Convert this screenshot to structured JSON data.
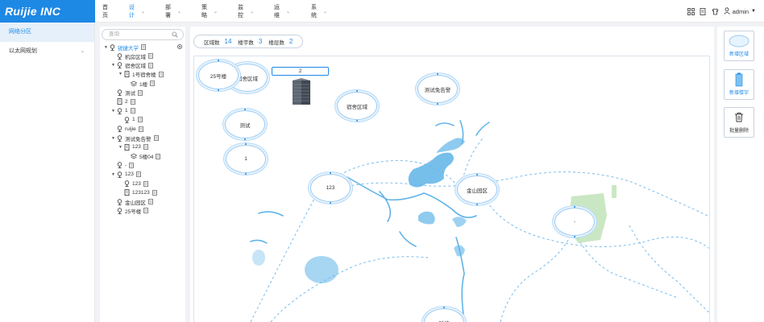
{
  "brand": {
    "logo_text": "Ruijie INC"
  },
  "nav": {
    "items": [
      {
        "label": "首页",
        "has_chevron": false,
        "active": false
      },
      {
        "label": "设计",
        "has_chevron": true,
        "active": true
      },
      {
        "label": "部署",
        "has_chevron": true,
        "active": false
      },
      {
        "label": "策略",
        "has_chevron": true,
        "active": false
      },
      {
        "label": "监控",
        "has_chevron": true,
        "active": false
      },
      {
        "label": "运维",
        "has_chevron": true,
        "active": false
      },
      {
        "label": "系统",
        "has_chevron": true,
        "active": false
      }
    ]
  },
  "header": {
    "user": "admin"
  },
  "sidebar": {
    "items": [
      {
        "label": "网络分区",
        "active": true
      },
      {
        "label": "以太网规划",
        "active": false
      }
    ]
  },
  "tree": {
    "search_placeholder": "查询",
    "nodes": [
      {
        "label": "锐捷大学",
        "depth": 0,
        "caret": "down",
        "icon": "pin",
        "selected": true
      },
      {
        "label": "机房区域",
        "depth": 1,
        "caret": "",
        "icon": "pin"
      },
      {
        "label": "宿舍区域",
        "depth": 1,
        "caret": "down",
        "icon": "pin"
      },
      {
        "label": "1号宿舍楼",
        "depth": 2,
        "caret": "down",
        "icon": "building"
      },
      {
        "label": "1楼",
        "depth": 3,
        "caret": "",
        "icon": "layers"
      },
      {
        "label": "测试",
        "depth": 1,
        "caret": "",
        "icon": "pin"
      },
      {
        "label": "2",
        "depth": 1,
        "caret": "",
        "icon": "building"
      },
      {
        "label": "1",
        "depth": 1,
        "caret": "down",
        "icon": "pin"
      },
      {
        "label": "1",
        "depth": 2,
        "caret": "",
        "icon": "pin"
      },
      {
        "label": "ruijie",
        "depth": 1,
        "caret": "",
        "icon": "pin"
      },
      {
        "label": "测试免告警",
        "depth": 1,
        "caret": "down",
        "icon": "pin"
      },
      {
        "label": "123",
        "depth": 2,
        "caret": "down",
        "icon": "building"
      },
      {
        "label": "5楼04",
        "depth": 3,
        "caret": "",
        "icon": "layers"
      },
      {
        "label": "-",
        "depth": 1,
        "caret": "",
        "icon": "pin"
      },
      {
        "label": "123",
        "depth": 1,
        "caret": "down",
        "icon": "pin"
      },
      {
        "label": "123",
        "depth": 2,
        "caret": "",
        "icon": "pin"
      },
      {
        "label": "123123",
        "depth": 2,
        "caret": "",
        "icon": "building"
      },
      {
        "label": "金山园区",
        "depth": 1,
        "caret": "",
        "icon": "pin"
      },
      {
        "label": "25号楼",
        "depth": 1,
        "caret": "",
        "icon": "pin"
      }
    ]
  },
  "stats": {
    "area_label": "区域数",
    "area_count": "14",
    "building_label": "楼宇数",
    "building_count": "3",
    "floor_label": "楼层数",
    "floor_count": "2"
  },
  "map": {
    "areas": [
      {
        "label": "25号楼"
      },
      {
        "label": "宿舍区域"
      },
      {
        "label": "测试免告警"
      },
      {
        "label": "宿舍区域"
      },
      {
        "label": "测试"
      },
      {
        "label": "1"
      },
      {
        "label": "123"
      },
      {
        "label": "金山园区"
      },
      {
        "label": "-"
      },
      {
        "label": "锐捷"
      }
    ],
    "building_label": "2"
  },
  "tools": {
    "new_area": "新增区域",
    "new_building": "新增楼宇",
    "batch_delete": "批量删除"
  },
  "colors": {
    "brand": "#1e88e5",
    "map_water": "#5fb4e8",
    "map_park": "#b8dfb0",
    "area_ring": "#9dcbf2"
  }
}
